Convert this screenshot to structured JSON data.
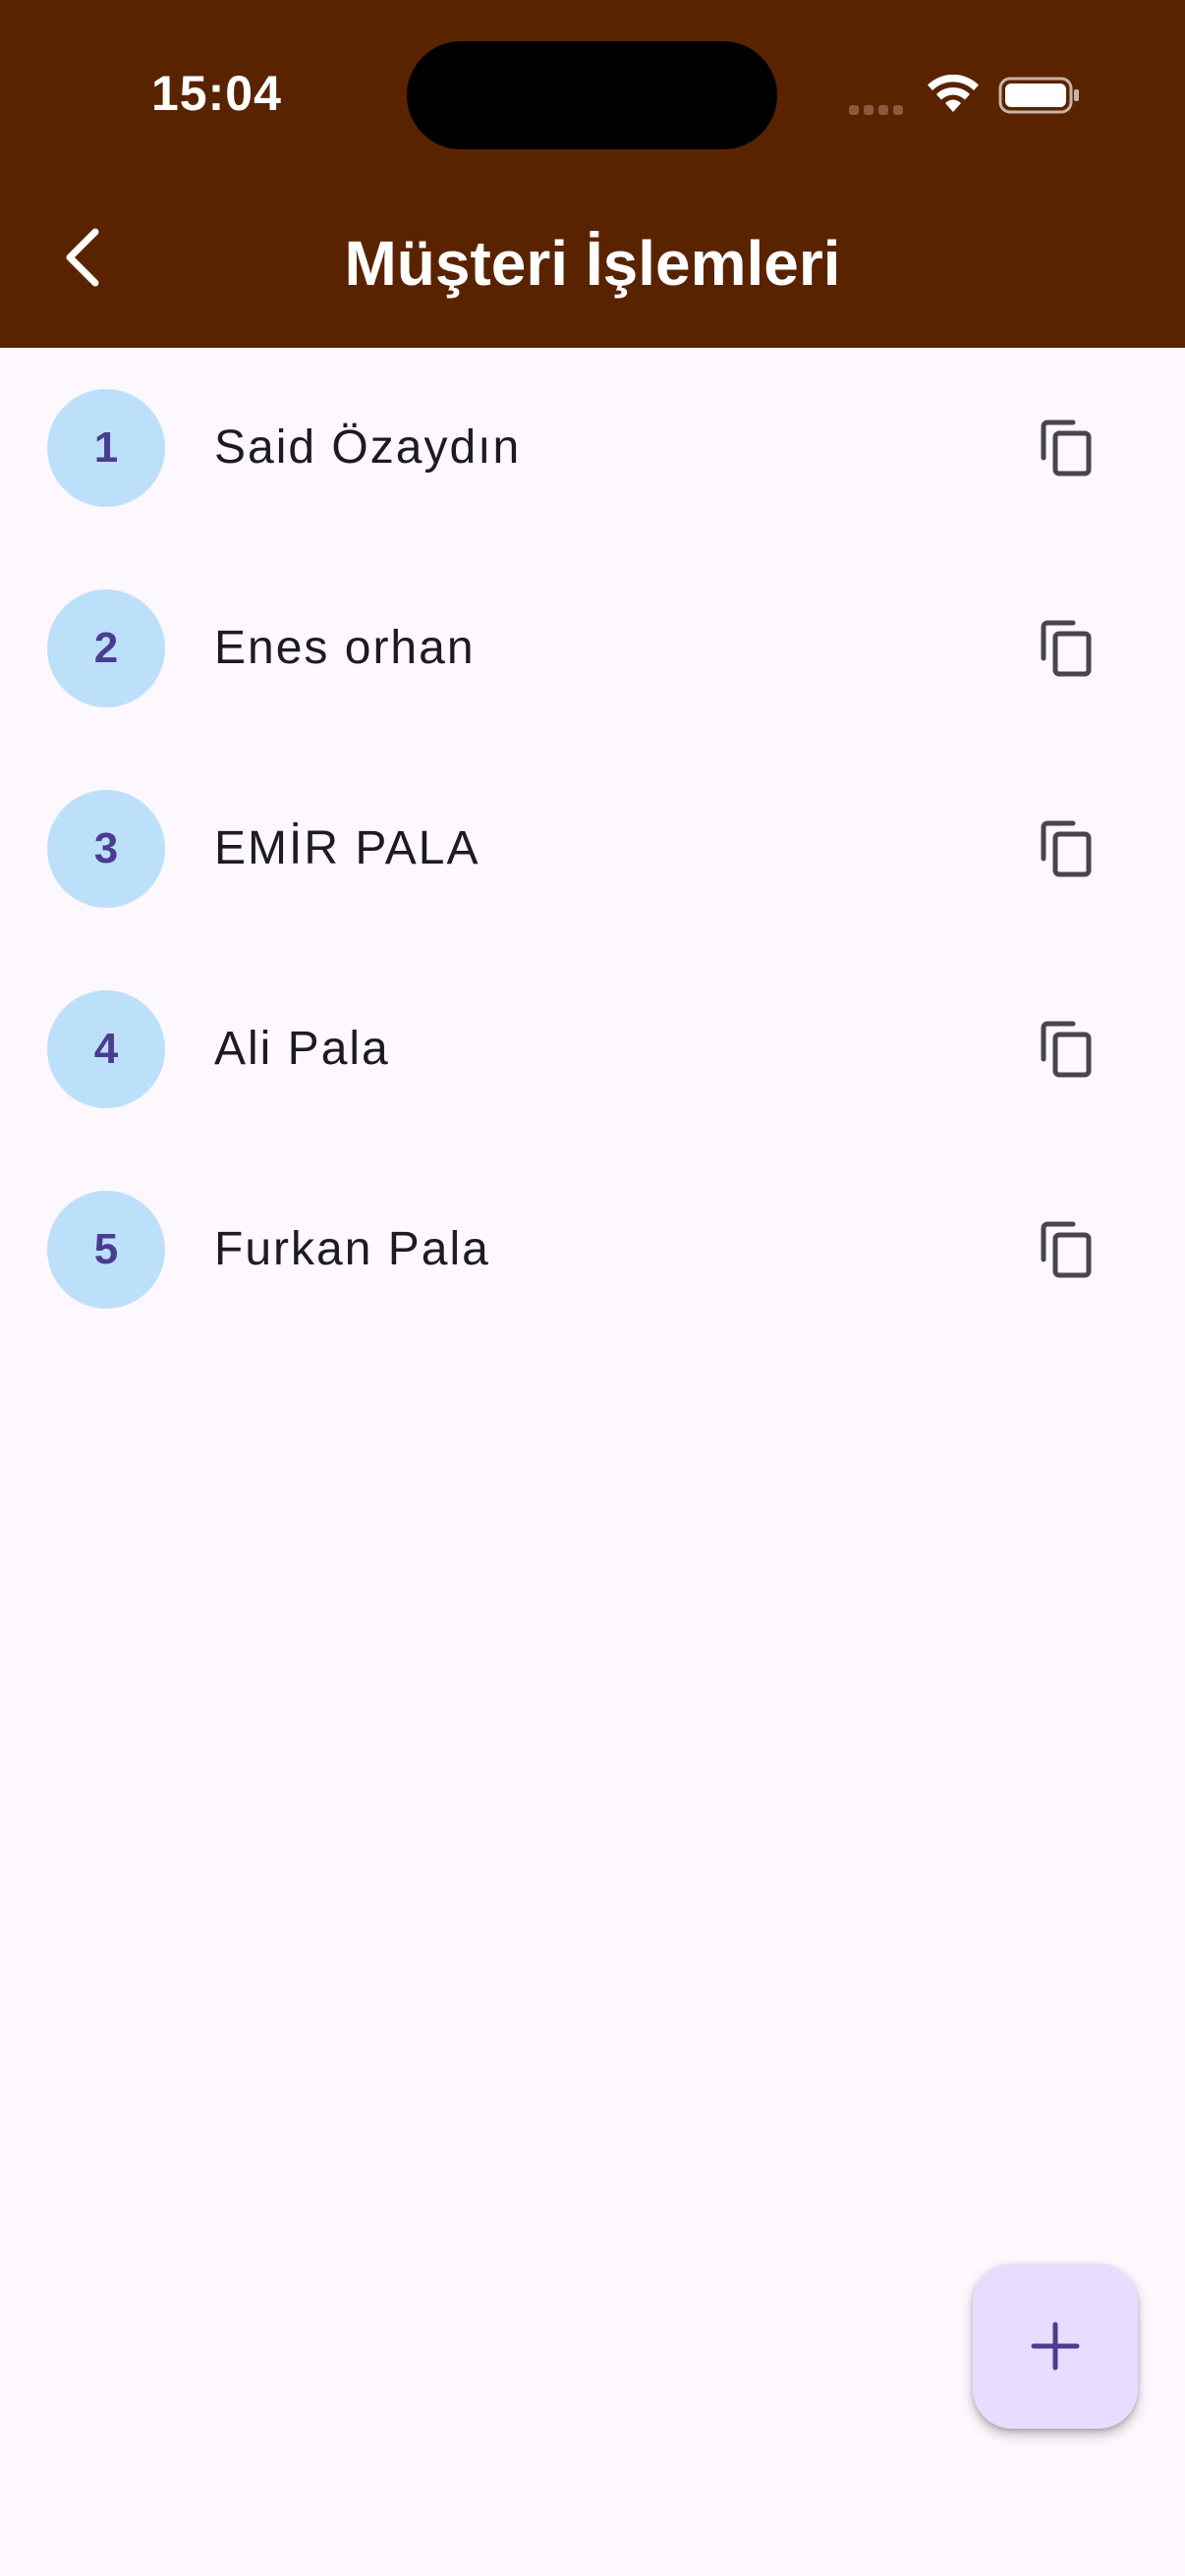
{
  "status_bar": {
    "time": "15:04"
  },
  "app_bar": {
    "title": "Müşteri İşlemleri",
    "background_color": "#5a2300",
    "back_icon": "chevron-left-icon"
  },
  "customers": [
    {
      "number": "1",
      "name": "Said Özaydın"
    },
    {
      "number": "2",
      "name": "Enes orhan"
    },
    {
      "number": "3",
      "name": "EMİR PALA"
    },
    {
      "number": "4",
      "name": "Ali Pala"
    },
    {
      "number": "5",
      "name": "Furkan Pala"
    }
  ],
  "row_action_icon": "copy-icon",
  "fab": {
    "icon": "plus-icon"
  },
  "colors": {
    "background": "#fdf7fe",
    "avatar": "#bde0fa",
    "avatar_text": "#4a3d8f",
    "fab": "#e9ddff",
    "fab_icon": "#4a3d8f"
  }
}
